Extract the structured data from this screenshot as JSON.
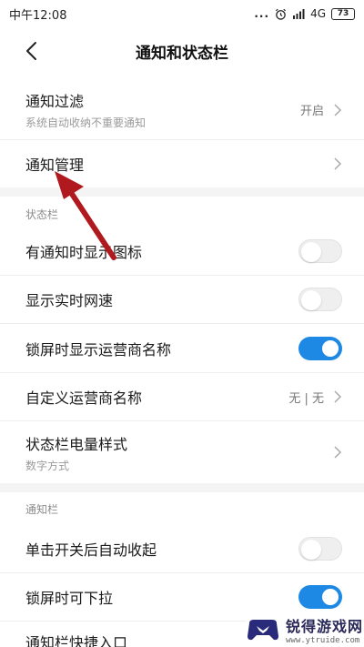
{
  "status_bar": {
    "time": "中午12:08",
    "dots": "...",
    "network": "4G",
    "battery": "73"
  },
  "header": {
    "title": "通知和状态栏"
  },
  "rows": {
    "notification_filter": {
      "title": "通知过滤",
      "subtitle": "系统自动收纳不重要通知",
      "value": "开启"
    },
    "notification_manage": {
      "title": "通知管理"
    }
  },
  "status_section": {
    "header": "状态栏",
    "show_icon": {
      "title": "有通知时显示图标",
      "enabled": false
    },
    "net_speed": {
      "title": "显示实时网速",
      "enabled": false
    },
    "carrier_lock": {
      "title": "锁屏时显示运营商名称",
      "enabled": true
    },
    "custom_carrier": {
      "title": "自定义运营商名称",
      "value": "无 | 无"
    },
    "battery_style": {
      "title": "状态栏电量样式",
      "subtitle": "数字方式"
    }
  },
  "notif_section": {
    "header": "通知栏",
    "auto_collapse": {
      "title": "单击开关后自动收起",
      "enabled": false
    },
    "lock_pulldown": {
      "title": "锁屏时可下拉",
      "enabled": true
    },
    "quick_entry": {
      "title": "通知栏快捷入口"
    }
  },
  "watermark": {
    "name": "锐得游戏网",
    "url": "www.ytruide.com"
  },
  "colors": {
    "accent": "#1e88e5",
    "arrow": "#b0191e"
  }
}
